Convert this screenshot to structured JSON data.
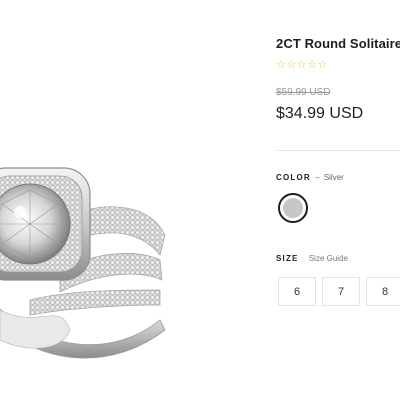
{
  "product": {
    "title": "2CT Round Solitaire",
    "rating_stars": "☆☆☆☆☆",
    "original_price": "$59.99 USD",
    "sale_price": "$34.99 USD",
    "image_icon": "ring-icon"
  },
  "color": {
    "label": "COLOR",
    "separator": "–",
    "selected": "Silver",
    "swatch_color": "#c6c6c6"
  },
  "size": {
    "label": "SIZE",
    "guide_link": "Size Guide",
    "options": [
      "6",
      "7",
      "8"
    ]
  }
}
